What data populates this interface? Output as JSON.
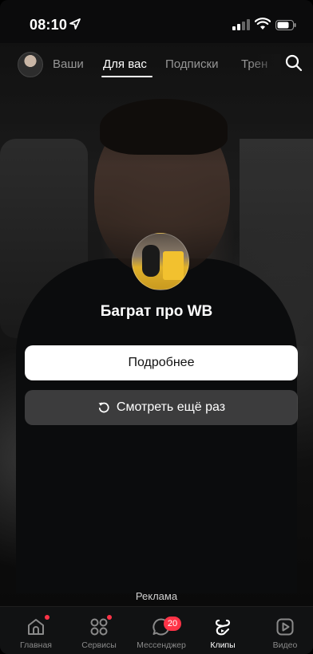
{
  "status": {
    "time": "08:10"
  },
  "top_nav": {
    "tabs": [
      {
        "label": "Ваши",
        "active": false
      },
      {
        "label": "Для вас",
        "active": true
      },
      {
        "label": "Подписки",
        "active": false
      },
      {
        "label": "Трен",
        "active": false
      }
    ]
  },
  "end_card": {
    "channel_name": "Баграт про WB",
    "more_button": "Подробнее",
    "replay_button": "Смотреть ещё раз"
  },
  "ad_label": "Реклама",
  "bottom_nav": {
    "items": [
      {
        "label": "Главная",
        "icon": "home-icon",
        "dot": true
      },
      {
        "label": "Сервисы",
        "icon": "services-icon",
        "dot": true
      },
      {
        "label": "Мессенджер",
        "icon": "messenger-icon",
        "badge": "20"
      },
      {
        "label": "Клипы",
        "icon": "clips-icon",
        "active": true
      },
      {
        "label": "Видео",
        "icon": "video-icon"
      }
    ]
  },
  "colors": {
    "accent_red": "#ff3347",
    "background": "#0e0f11"
  }
}
